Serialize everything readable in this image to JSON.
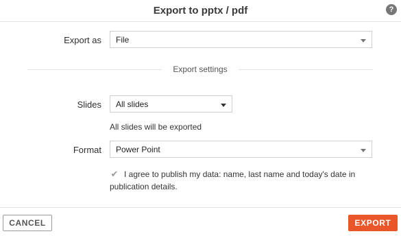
{
  "dialog": {
    "title": "Export to pptx / pdf",
    "help_icon": "question-icon",
    "help_glyph": "?"
  },
  "export_as": {
    "label": "Export as",
    "value": "File"
  },
  "section": {
    "label": "Export settings"
  },
  "slides": {
    "label": "Slides",
    "value": "All slides",
    "hint": "All slides will be exported"
  },
  "format": {
    "label": "Format",
    "value": "Power Point"
  },
  "consent": {
    "checked": true,
    "text": "I agree to publish my data: name, last name and today's date in publication details."
  },
  "footer": {
    "cancel_label": "CANCEL",
    "export_label": "EXPORT"
  },
  "colors": {
    "accent": "#e8562a",
    "border": "#cfcfcf",
    "divider": "#e4e4e4"
  }
}
